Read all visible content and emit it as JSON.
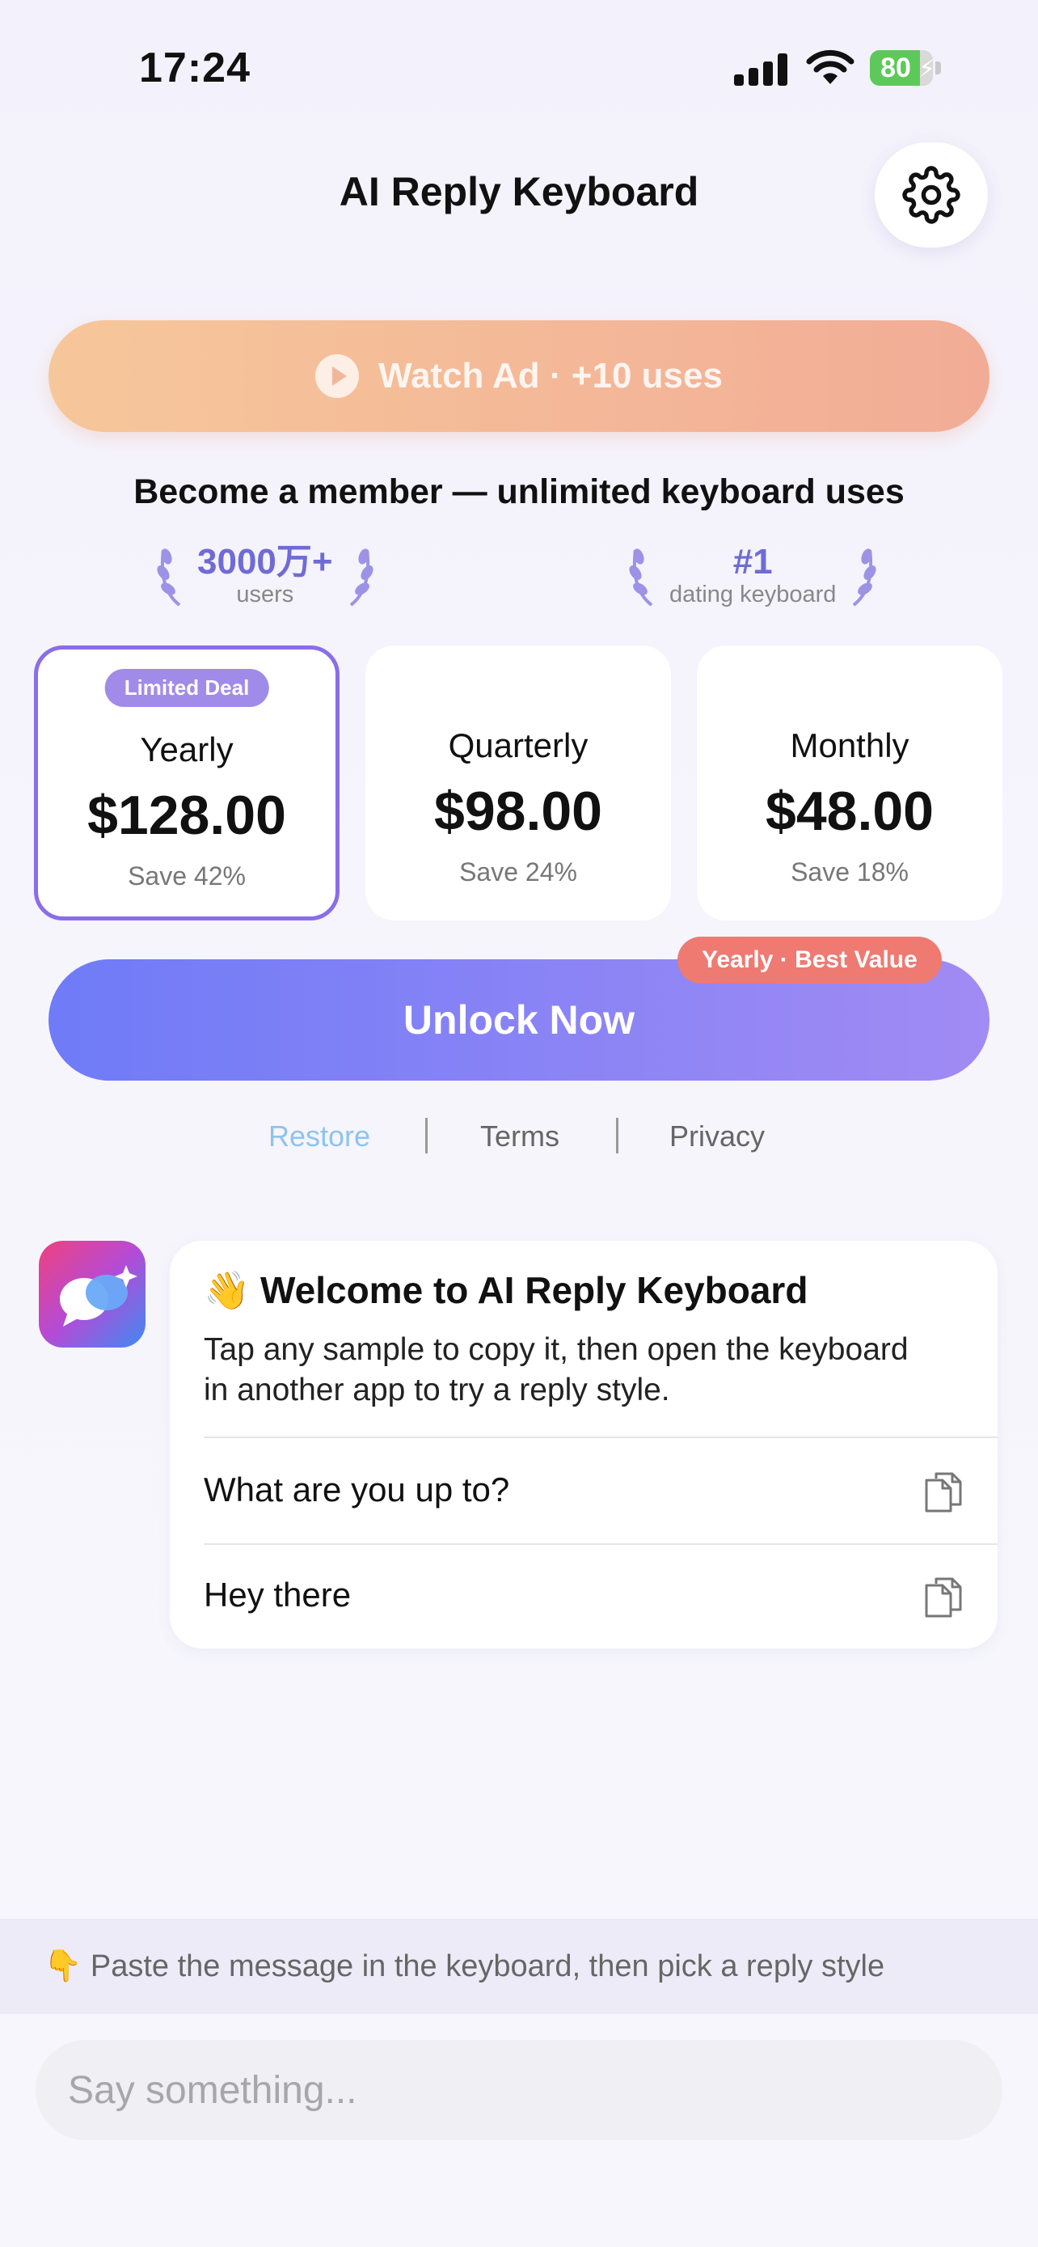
{
  "status_bar": {
    "time": "17:24",
    "battery": "80"
  },
  "header": {
    "title": "AI Reply Keyboard"
  },
  "watch_ad": {
    "label": "Watch Ad · +10 uses"
  },
  "membership": {
    "headline": "Become a member — unlimited keyboard uses",
    "stats": [
      {
        "main": "3000万+",
        "sub": "users"
      },
      {
        "main": "#1",
        "sub": "dating keyboard"
      }
    ]
  },
  "plans": [
    {
      "badge": "Limited Deal",
      "name": "Yearly",
      "price": "$128.00",
      "save": "Save 42%",
      "selected": true
    },
    {
      "name": "Quarterly",
      "price": "$98.00",
      "save": "Save 24%",
      "selected": false
    },
    {
      "name": "Monthly",
      "price": "$48.00",
      "save": "Save 18%",
      "selected": false
    }
  ],
  "unlock": {
    "label": "Unlock Now",
    "badge": "Yearly · Best Value"
  },
  "links": {
    "restore": "Restore",
    "terms": "Terms",
    "privacy": "Privacy"
  },
  "welcome": {
    "title": "👋 Welcome to AI Reply Keyboard",
    "desc": "Tap any sample to copy it, then open the keyboard in another app to try a reply style.",
    "samples": [
      "What are you up to?",
      "Hey there"
    ]
  },
  "hint": "👇 Paste the message in the keyboard, then pick a reply style",
  "input": {
    "placeholder": "Say something..."
  },
  "colors": {
    "accent": "#6f7bf7",
    "selected_border": "#8a6ee8",
    "badge_red": "#ee7a72",
    "ad_orange": "#f6c79a",
    "restore_link": "#8ec4ec"
  }
}
